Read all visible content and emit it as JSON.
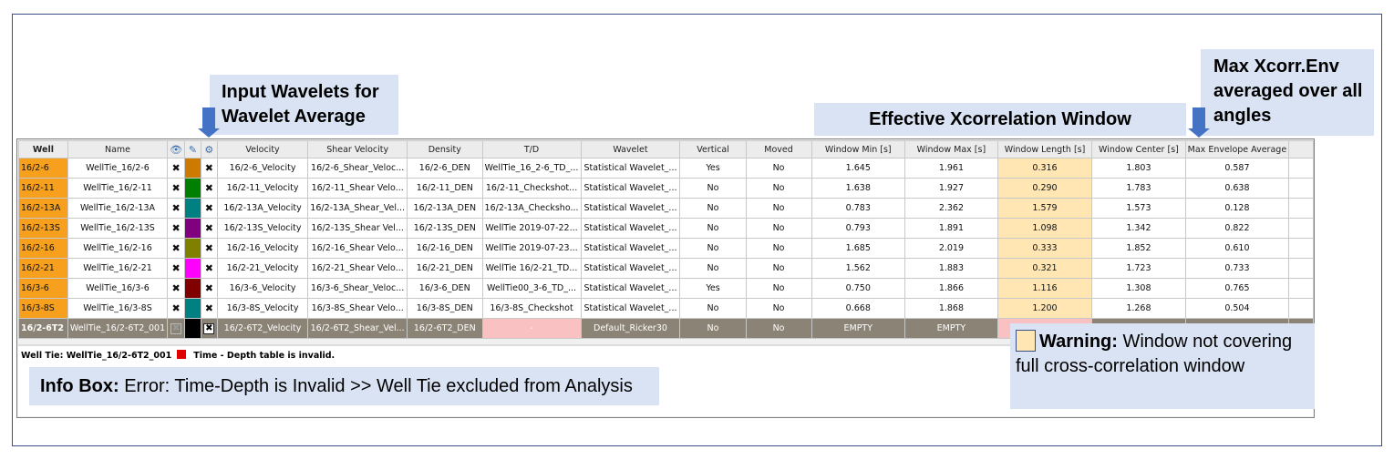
{
  "callouts": {
    "input_wavelets": "Input Wavelets for Wavelet Average",
    "effective_window": "Effective Xcorrelation Window",
    "max_xcorr": "Max Xcorr.Env averaged over all angles",
    "info_box_label": "Info Box:",
    "info_box_text": " Error: Time-Depth is Invalid >> Well Tie excluded from Analysis",
    "warning_label": "Warning:",
    "warning_text": " Window not covering full cross-correlation window"
  },
  "table": {
    "headers": {
      "well": "Well",
      "name": "Name",
      "velocity": "Velocity",
      "shear": "Shear Velocity",
      "density": "Density",
      "td": "T/D",
      "wavelet": "Wavelet",
      "vertical": "Vertical",
      "moved": "Moved",
      "wmin": "Window Min [s]",
      "wmax": "Window Max [s]",
      "wlen": "Window Length [s]",
      "wcen": "Window Center [s]",
      "maxenv": "Max Envelope Average"
    },
    "icons": {
      "visible": "eye-icon",
      "color": "pencil-icon",
      "include": "gear-icon"
    },
    "rows": [
      {
        "well": "16/2-6",
        "name": "WellTie_16/2-6",
        "color": "#cc7a00",
        "velocity": "16/2-6_Velocity",
        "shear": "16/2-6_Shear_Veloc...",
        "density": "16/2-6_DEN",
        "td": "WellTie_16_2-6_TD_...",
        "wavelet": "Statistical Wavelet_...",
        "vertical": "Yes",
        "moved": "No",
        "wmin": "1.645",
        "wmax": "1.961",
        "wlen": "0.316",
        "wcen": "1.803",
        "maxenv": "0.587"
      },
      {
        "well": "16/2-11",
        "name": "WellTie_16/2-11",
        "color": "#008000",
        "velocity": "16/2-11_Velocity",
        "shear": "16/2-11_Shear Velo...",
        "density": "16/2-11_DEN",
        "td": "16/2-11_Checkshot...",
        "wavelet": "Statistical Wavelet_...",
        "vertical": "No",
        "moved": "No",
        "wmin": "1.638",
        "wmax": "1.927",
        "wlen": "0.290",
        "wcen": "1.783",
        "maxenv": "0.638"
      },
      {
        "well": "16/2-13A",
        "name": "WellTie_16/2-13A",
        "color": "#008080",
        "velocity": "16/2-13A_Velocity",
        "shear": "16/2-13A_Shear_Vel...",
        "density": "16/2-13A_DEN",
        "td": "16/2-13A_Checksho...",
        "wavelet": "Statistical Wavelet_...",
        "vertical": "No",
        "moved": "No",
        "wmin": "0.783",
        "wmax": "2.362",
        "wlen": "1.579",
        "wcen": "1.573",
        "maxenv": "0.128"
      },
      {
        "well": "16/2-13S",
        "name": "WellTie_16/2-13S",
        "color": "#800080",
        "velocity": "16/2-13S_Velocity",
        "shear": "16/2-13S_Shear Vel...",
        "density": "16/2-13S_DEN",
        "td": "WellTie 2019-07-22...",
        "wavelet": "Statistical Wavelet_...",
        "vertical": "No",
        "moved": "No",
        "wmin": "0.793",
        "wmax": "1.891",
        "wlen": "1.098",
        "wcen": "1.342",
        "maxenv": "0.822"
      },
      {
        "well": "16/2-16",
        "name": "WellTie_16/2-16",
        "color": "#808000",
        "velocity": "16/2-16_Velocity",
        "shear": "16/2-16_Shear Velo...",
        "density": "16/2-16_DEN",
        "td": "WellTie 2019-07-23...",
        "wavelet": "Statistical Wavelet_...",
        "vertical": "No",
        "moved": "No",
        "wmin": "1.685",
        "wmax": "2.019",
        "wlen": "0.333",
        "wcen": "1.852",
        "maxenv": "0.610"
      },
      {
        "well": "16/2-21",
        "name": "WellTie_16/2-21",
        "color": "#ff00ff",
        "velocity": "16/2-21_Velocity",
        "shear": "16/2-21_Shear Velo...",
        "density": "16/2-21_DEN",
        "td": "WellTie 16/2-21_TD...",
        "wavelet": "Statistical Wavelet_...",
        "vertical": "No",
        "moved": "No",
        "wmin": "1.562",
        "wmax": "1.883",
        "wlen": "0.321",
        "wcen": "1.723",
        "maxenv": "0.733"
      },
      {
        "well": "16/3-6",
        "name": "WellTie_16/3-6",
        "color": "#800000",
        "velocity": "16/3-6_Velocity",
        "shear": "16/3-6_Shear_Veloc...",
        "density": "16/3-6_DEN",
        "td": "WellTie00_3-6_TD_...",
        "wavelet": "Statistical Wavelet_...",
        "vertical": "Yes",
        "moved": "No",
        "wmin": "0.750",
        "wmax": "1.866",
        "wlen": "1.116",
        "wcen": "1.308",
        "maxenv": "0.765"
      },
      {
        "well": "16/3-8S",
        "name": "WellTie_16/3-8S",
        "color": "#008080",
        "velocity": "16/3-8S_Velocity",
        "shear": "16/3-8S_Shear Velo...",
        "density": "16/3-8S_DEN",
        "td": "16/3-8S_Checkshot",
        "wavelet": "Statistical Wavelet_...",
        "vertical": "No",
        "moved": "No",
        "wmin": "0.668",
        "wmax": "1.868",
        "wlen": "1.200",
        "wcen": "1.268",
        "maxenv": "0.504"
      }
    ],
    "error_row": {
      "well": "16/2-6T2",
      "name": "WellTie_16/2-6T2_001",
      "color": "#000000",
      "velocity": "16/2-6T2_Velocity",
      "shear": "16/2-6T2_Shear_Vel...",
      "density": "16/2-6T2_DEN",
      "td": "-",
      "wavelet": "Default_Ricker30",
      "vertical": "No",
      "moved": "No",
      "wmin": "EMPTY",
      "wmax": "EMPTY",
      "wlen": "",
      "wcen": "",
      "maxenv": ""
    }
  },
  "status": {
    "well_tie": "Well Tie: WellTie_16/2-6T2_001",
    "message": "Time - Depth table is invalid."
  }
}
